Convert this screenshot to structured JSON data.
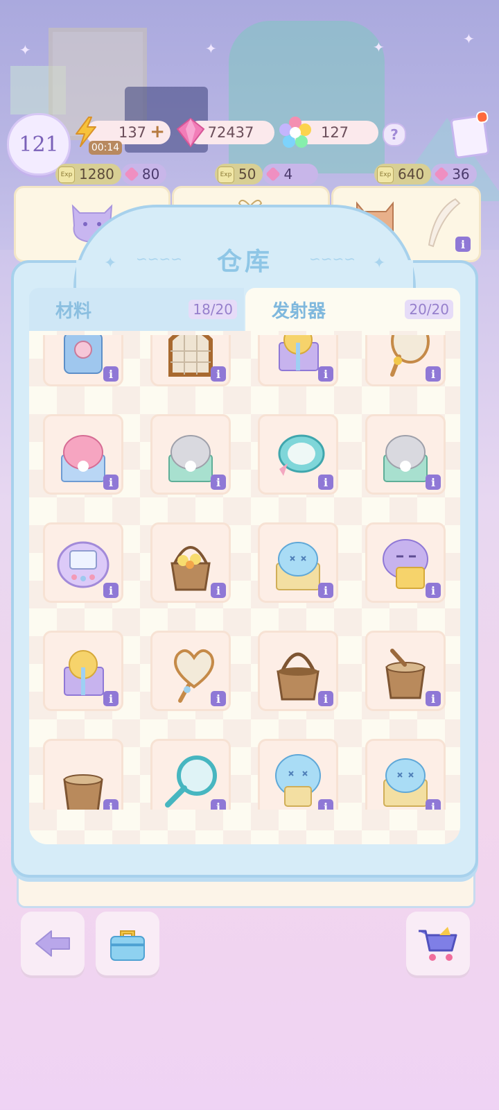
{
  "hud": {
    "level": "121",
    "energy": "137",
    "energy_plus": "+",
    "energy_timer": "00:14",
    "gems": "72437",
    "stars": "127",
    "help": "?"
  },
  "rewards": [
    {
      "exp": "1280",
      "gem": "80"
    },
    {
      "exp": "50",
      "gem": "4"
    },
    {
      "exp": "640",
      "gem": "36"
    }
  ],
  "exp_icon_text": "Exp",
  "warehouse": {
    "title": "仓库",
    "tabs": [
      {
        "label": "材料",
        "count": "18/20"
      },
      {
        "label": "发射器",
        "count": "20/20"
      }
    ],
    "info_glyph": "i",
    "items": [
      "capsule-machine",
      "wicker-net",
      "purple-gift-bundle",
      "mirror-net",
      "pink-gift-bundle",
      "gray-gift-bundle",
      "teal-cat-bowl",
      "gray-gift-bundle",
      "purple-tamagotchi",
      "flower-basket",
      "blue-gift-bundle",
      "purple-ghost-gift",
      "purple-gift-bundle",
      "heart-net",
      "wicker-basket",
      "wooden-bucket",
      "wicker-pot",
      "teal-magnifier-net",
      "blue-ghost-gift",
      "blue-gift-bundle"
    ]
  },
  "colors": {
    "panel": "#d6ecf8",
    "panel_border": "#a7d1ec",
    "info_badge": "#8f78d6",
    "cell_bg": "#fdeee6"
  },
  "buttons": {
    "back": "back-arrow-icon",
    "toolbox": "toolbox-icon",
    "shop": "shopping-cart-icon"
  }
}
